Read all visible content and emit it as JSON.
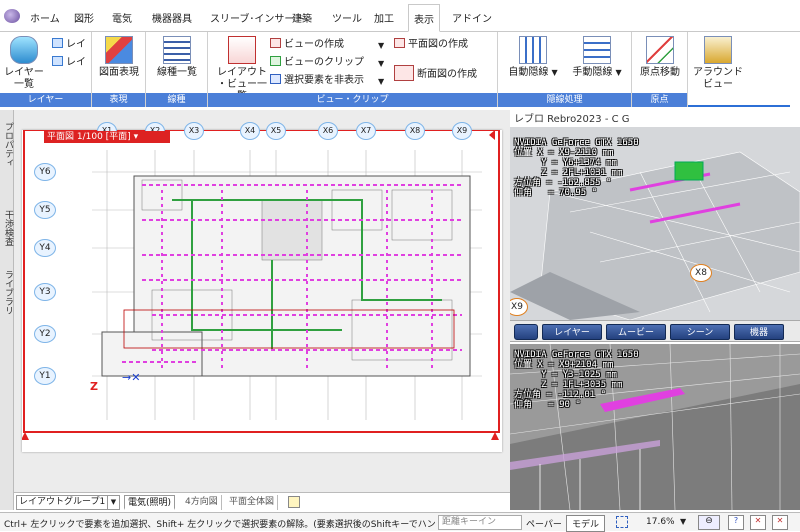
{
  "tabs": [
    "ホーム",
    "図形",
    "電気",
    "機器器具",
    "スリーブ･インサート",
    "建築",
    "ツール",
    "加工",
    "表示",
    "アドイン"
  ],
  "active_tab": "表示",
  "ribbon": {
    "groups": {
      "layer": "レイヤー",
      "hyogen": "表現",
      "senshu": "線種",
      "view_clip": "ビュー・クリップ",
      "inpei": "隠線処理",
      "genten": "原点"
    },
    "layer_btn": "レイヤー\n一覧",
    "layer_small1": "レイ",
    "layer_small2": "レイ",
    "zumen_btn": "図面表現",
    "senshu_btn": "線種一覧",
    "layout_btn": "レイアウト\n・ビュー一覧",
    "view_create": "ビューの作成",
    "view_clip": "ビューのクリップ",
    "hide_select": "選択要素を非表示",
    "plan_create": "平面図の作成",
    "section_create": "断面図の作成",
    "auto_hidden": "自動隠線",
    "manual_hidden": "手動隠線",
    "origin_move": "原点移動",
    "around_view": "アラウンド\nビュー"
  },
  "side_tabs": [
    "プロパティ",
    "干渉検査",
    "ライブラリ"
  ],
  "view_title": "平面図 1/100 [平面]",
  "grid_x": [
    "X1",
    "X2",
    "X3",
    "X4",
    "X5",
    "X6",
    "X7",
    "X8",
    "X9"
  ],
  "grid_y": [
    "Y6",
    "Y5",
    "Y4",
    "Y3",
    "Y2",
    "Y1"
  ],
  "z_label": "Z",
  "layout_group": "レイアウトグループ1",
  "layout_tabs": [
    "電気(照明)",
    "4方向図",
    "平面全体図"
  ],
  "status": {
    "hint": "Ctrl+ 左クリックで要素を追加選択、Shift+ 左クリックで選択要素の解除。(要素選択後のShiftキーでハン...",
    "distance": "距離キーイン",
    "paper": "ペーパー",
    "model": "モデル",
    "zoom": "17.6%"
  },
  "render_top": {
    "title": "レブロ Rebro2023 - C G",
    "hud": [
      "NVIDIA GeForce GTX 1650",
      "位置 X = X9-2110 mm",
      "     Y = Y6+1374 mm",
      "     Z = 2FL+1031 mm",
      "方位角 = -162.855 °",
      "仰角   = 70.95 °"
    ],
    "labels": [
      "X8",
      "X9"
    ]
  },
  "render_toolbar": [
    "レイヤー",
    "ムービー",
    "シーン",
    "機器"
  ],
  "render_bottom": {
    "hud": [
      "NVIDIA GeForce GTX 1650",
      "位置 X = X9+2104 mm",
      "     Y = Y3-1025 mm",
      "     Z = 1FL+3035 mm",
      "方位角 = -112.01 °",
      "仰角   = 90 °"
    ]
  },
  "colors": {
    "accent": "#4b7fd8",
    "frame": "#e02020",
    "magenta": "#e040e0",
    "ribbon_line": "#2c6fd6"
  }
}
